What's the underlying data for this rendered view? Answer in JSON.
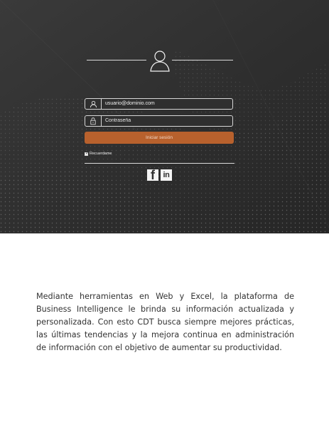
{
  "login": {
    "email_value": "usuario@dominio.com",
    "password_placeholder": "Contraseña",
    "submit_label": "Iniciar sesión",
    "remember_label": "Recuerdame"
  },
  "social": {
    "facebook_label": "f",
    "linkedin_label": "in"
  },
  "description": "Mediante herramientas en Web y Excel, la plataforma de Business Intelligence le brinda su información actualizada y personalizada. Con esto CDT busca siempre mejores prácticas, las últimas tendencias y la mejora continua en administración de información con el objetivo de aumentar su productividad.",
  "colors": {
    "background": "#2f2f2f",
    "accent": "#b8612d",
    "text": "#333333"
  },
  "icons": {
    "profile": "user-profile-icon",
    "email": "user-icon",
    "password": "lock-icon",
    "facebook": "facebook-icon",
    "linkedin": "linkedin-icon"
  }
}
